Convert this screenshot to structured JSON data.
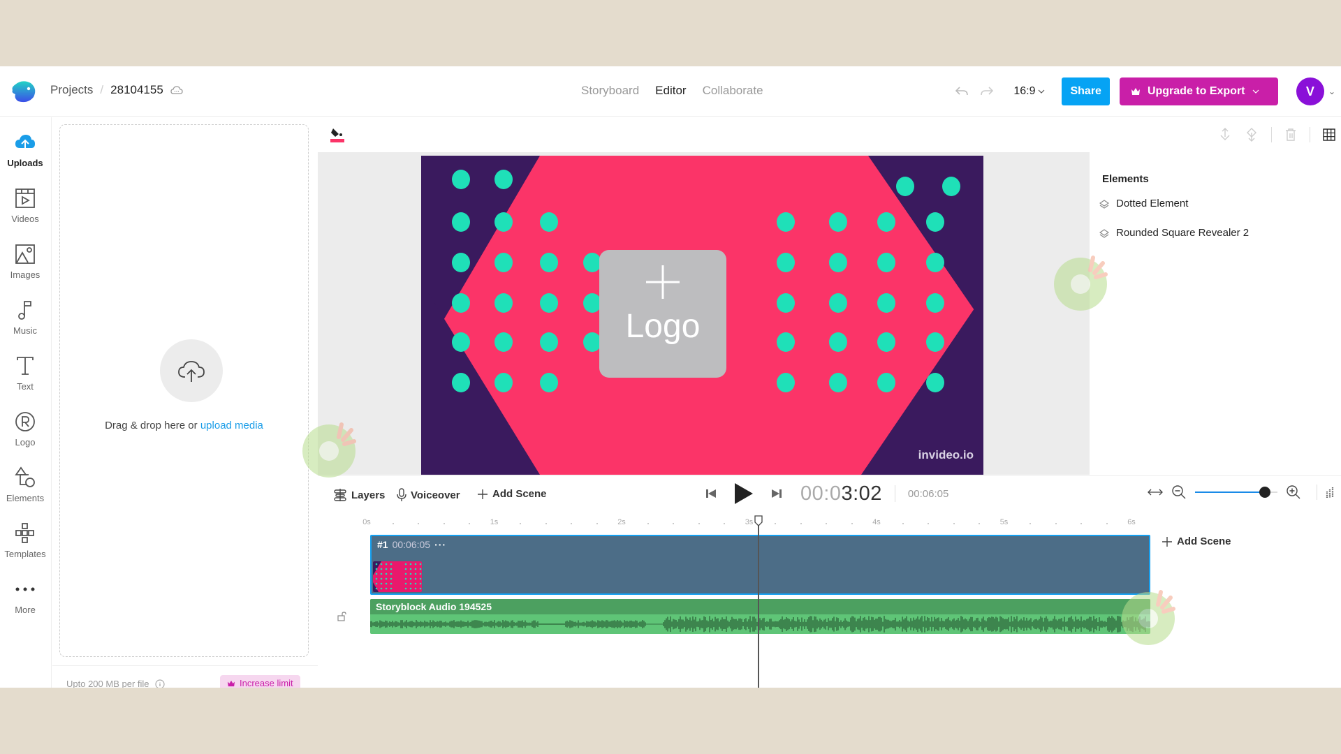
{
  "header": {
    "breadcrumb": {
      "projects": "Projects",
      "separator": "/",
      "project_id": "28104155"
    },
    "tabs": [
      {
        "label": "Storyboard",
        "active": false
      },
      {
        "label": "Editor",
        "active": true
      },
      {
        "label": "Collaborate",
        "active": false
      }
    ],
    "aspect_ratio": "16:9",
    "share_label": "Share",
    "upgrade_label": "Upgrade to Export",
    "avatar_initial": "V",
    "colors": {
      "share": "#06a3f4",
      "upgrade": "#c91fa8",
      "avatar": "#8a10d8"
    }
  },
  "sidebar": {
    "items": [
      {
        "label": "Uploads",
        "icon": "cloud-upload-icon",
        "active": true
      },
      {
        "label": "Videos",
        "icon": "video-icon",
        "active": false
      },
      {
        "label": "Images",
        "icon": "image-icon",
        "active": false
      },
      {
        "label": "Music",
        "icon": "music-note-icon",
        "active": false
      },
      {
        "label": "Text",
        "icon": "text-icon",
        "active": false
      },
      {
        "label": "Logo",
        "icon": "registered-icon",
        "active": false
      },
      {
        "label": "Elements",
        "icon": "shapes-icon",
        "active": false
      },
      {
        "label": "Templates",
        "icon": "templates-icon",
        "active": false
      },
      {
        "label": "More",
        "icon": "more-dots-icon",
        "active": false
      }
    ]
  },
  "uploads": {
    "drop_text": "Drag & drop here or ",
    "upload_link": "upload media",
    "limit_text": "Upto 200 MB per file",
    "increase_label": "Increase limit"
  },
  "canvas": {
    "logo_placeholder": "Logo",
    "watermark": "invideo.io",
    "colors": {
      "background": "#fb3468",
      "stripes": "#3a1a5e",
      "dots": "#1fe0b8"
    }
  },
  "elements_panel": {
    "title": "Elements",
    "items": [
      {
        "label": "Dotted Element"
      },
      {
        "label": "Rounded Square Revealer 2"
      }
    ]
  },
  "timeline": {
    "layers_label": "Layers",
    "voiceover_label": "Voiceover",
    "add_scene_label": "Add Scene",
    "current_time_dim": "00:0",
    "current_time_bright": "3:02",
    "total_time": "00:06:05",
    "zoom_level": 0.85,
    "ruler_ticks": [
      "0s",
      "1s",
      "2s",
      "3s",
      "4s",
      "5s",
      "6s"
    ],
    "playhead_seconds": 3.07,
    "scene": {
      "number": "#1",
      "duration": "00:06:05"
    },
    "audio": {
      "title": "Storyblock Audio 194525"
    },
    "add_scene_end_label": "Add Scene"
  }
}
